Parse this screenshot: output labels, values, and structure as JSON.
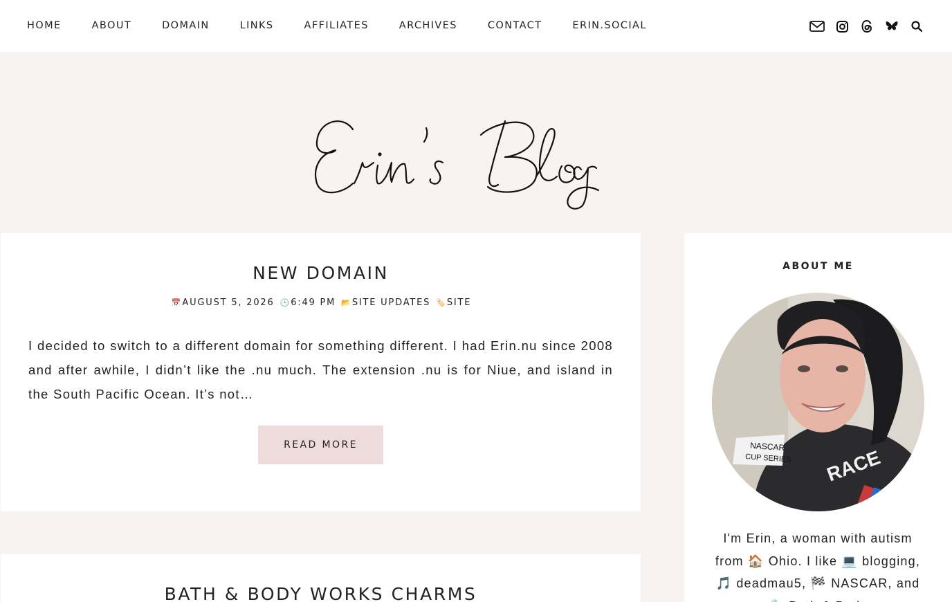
{
  "nav": {
    "items": [
      "HOME",
      "ABOUT",
      "DOMAIN",
      "LINKS",
      "AFFILIATES",
      "ARCHIVES",
      "CONTACT",
      "ERIN.SOCIAL"
    ]
  },
  "social_icons": [
    "mail-icon",
    "instagram-icon",
    "threads-icon",
    "bluesky-icon",
    "search-icon"
  ],
  "header": {
    "logo_text": "Erin's Blog"
  },
  "posts": [
    {
      "title": "NEW DOMAIN",
      "meta": {
        "date_emoji": "📅",
        "date": "AUGUST 5, 2026",
        "time_emoji": "🕒",
        "time": "6:49 PM",
        "category_emoji": "📂",
        "category": "SITE UPDATES",
        "tag_emoji": "🏷️",
        "tag": "SITE"
      },
      "excerpt": "I decided to switch to a different domain for something different. I had Erin.nu since 2008 and after awhile, I didn’t like the .nu much. The extension .nu is for Niue, and island in the South Pacific Ocean. It’s not…",
      "read_more": "READ MORE"
    },
    {
      "title": "BATH & BODY WORKS CHARMS"
    }
  ],
  "sidebar": {
    "about_title": "ABOUT ME",
    "bio": "I'm Erin, a woman with autism from 🏠 Ohio. I like 💻 blogging, 🎵 deadmau5, 🏁 NASCAR, and 🔩 Bath & Body"
  },
  "colors": {
    "background": "#f8f3f1",
    "card": "#ffffff",
    "button": "#eddcdb",
    "text": "#222222"
  }
}
